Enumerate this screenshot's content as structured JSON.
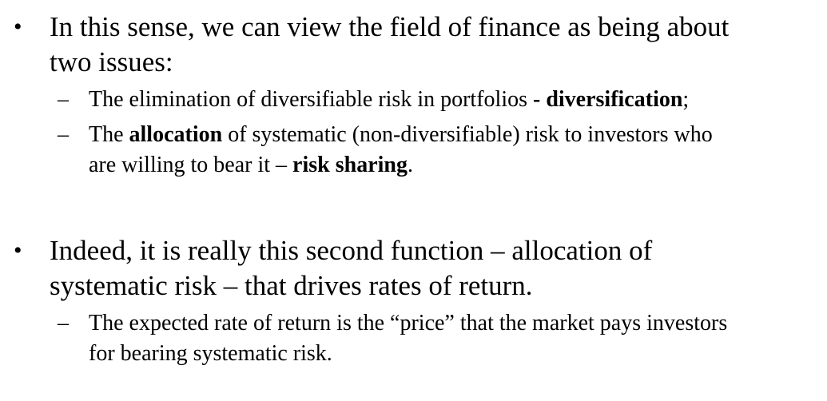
{
  "bullets": [
    {
      "marker": "•",
      "lines": [
        "In this sense, we can view the field of finance as being about",
        "two issues:"
      ],
      "subitems": [
        {
          "marker": "–",
          "line1": {
            "a": "The elimination of diversifiable risk in portfolios ",
            "b": "- diversification",
            "c": ";"
          }
        },
        {
          "marker": "–",
          "line1": {
            "a": "The ",
            "b": "allocation",
            "c": " of systematic (non-diversifiable) risk to investors who"
          },
          "line2": {
            "a": "are willing to bear it – ",
            "b": "risk sharing",
            "c": "."
          }
        }
      ]
    },
    {
      "marker": "•",
      "lines": [
        "Indeed, it is really this second function – allocation of",
        "systematic risk – that drives rates of return."
      ],
      "subitems": [
        {
          "marker": "–",
          "lines": [
            "The expected rate of return is the “price” that the market pays investors",
            "for bearing systematic risk."
          ]
        }
      ]
    }
  ]
}
